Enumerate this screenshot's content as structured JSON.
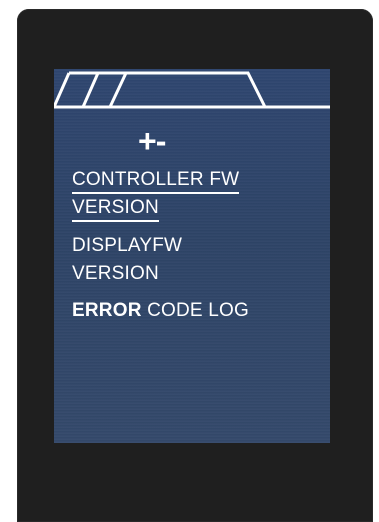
{
  "screen": {
    "icons": {
      "plus": "+",
      "minus": "-",
      "plus_icon": "plus-icon",
      "minus_icon": "minus-icon"
    },
    "menu": [
      {
        "line1": "CONTROLLER FW",
        "line2": "VERSION",
        "selected": true
      },
      {
        "line1": "DISPLAYFW",
        "line2": "VERSION",
        "selected": false
      },
      {
        "bold": "ERROR",
        "rest": " CODE LOG",
        "selected": false
      }
    ]
  },
  "colors": {
    "bezel": "#1f1f1f",
    "screen_bg": "#2f4670",
    "text": "#ffffff"
  }
}
